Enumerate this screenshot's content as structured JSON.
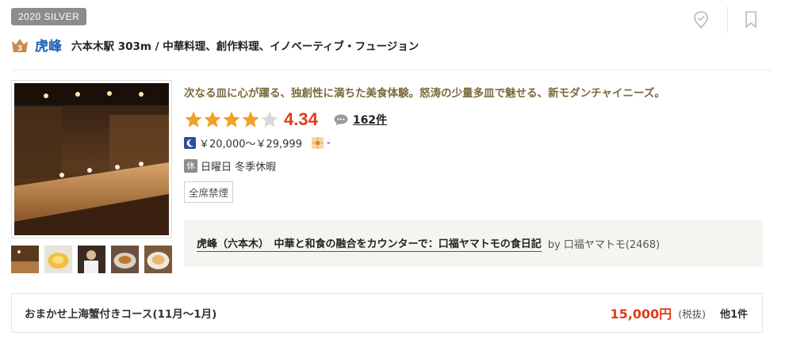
{
  "badge": "2020 SILVER",
  "restaurant": {
    "rank_icon": "bronze-crown-icon",
    "rank_number": "3",
    "name": "虎峰",
    "subinfo": "六本木駅 303m / 中華料理、創作料理、イノベーティブ・フュージョン"
  },
  "catchcopy": "次なる皿に心が躍る、独創性に満ちた美食体験。怒涛の少量多皿で魅せる、新モダンチャイニーズ。",
  "rating": {
    "stars_filled": 4,
    "stars_total": 5,
    "score": "4.34",
    "review_count": "162件",
    "colors": {
      "star": "#f0a12a",
      "score": "#e03c1b"
    }
  },
  "price": {
    "dinner_icon": "moon-icon",
    "dinner": "￥20,000～￥29,999",
    "lunch_icon": "sun-icon",
    "lunch": "-"
  },
  "holiday": {
    "icon_label": "休",
    "text": "日曜日 冬季休暇"
  },
  "smoking_tag": "全席禁煙",
  "review": {
    "title": "虎峰（六本木）　中華と和食の融合をカウンターで：口福ヤマトモの食日記",
    "by": "by 口福ヤマトモ(2468)"
  },
  "course": {
    "name": "おまかせ上海蟹付きコース(11月～1月)",
    "price": "15,000円",
    "tax": "(税抜)",
    "more": "他1件"
  },
  "top_icons": [
    "check-badge-icon",
    "bookmark-icon"
  ],
  "thumbnail_count": 5
}
